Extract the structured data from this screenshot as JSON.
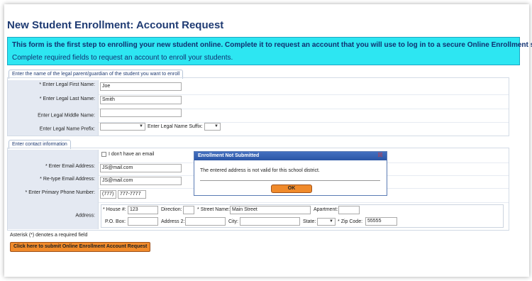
{
  "page": {
    "title": "New Student Enrollment: Account Request",
    "banner_bold": "This form is the first step to enrolling your new student online. Complete it to request an account that you will use to log in to a secure Online Enrollment system.",
    "banner_text": "Complete required fields to request an account to enroll your students."
  },
  "parent_section": {
    "tab": "Enter the name of the legal parent/guardian of the student you want to enroll",
    "first_name_label": "Enter Legal First Name:",
    "first_name_value": "Joe",
    "last_name_label": "Enter Legal Last Name:",
    "last_name_value": "Smith",
    "middle_name_label": "Enter Legal Middle Name:",
    "middle_name_value": "",
    "prefix_label": "Enter Legal Name Prefix:",
    "prefix_value": "",
    "suffix_label": "Enter Legal Name Suffix:",
    "suffix_value": ""
  },
  "contact_section": {
    "tab": "Enter contact information",
    "no_email_label": "I don't have an email",
    "email_label": "Enter Email Address:",
    "email_value": "JS@mail.com",
    "reemail_label": "Re-type Email Address:",
    "reemail_value": "JS@mail.com",
    "phone_label": "Enter Primary Phone Number:",
    "phone_area": "(777)",
    "phone_number": "777-7777",
    "address_label": "Address:",
    "house_label": "House #:",
    "house_value": "123",
    "direction_label": "Direction:",
    "street_label": "Street Name:",
    "street_value": "Main Street",
    "apartment_label": "Apartment:",
    "pobox_label": "P.O. Box:",
    "address2_label": "Address 2:",
    "city_label": "City:",
    "state_label": "State:",
    "zip_label": "Zip Code:",
    "zip_value": "55555"
  },
  "footer": {
    "required_note": "Asterisk (*) denotes a required field",
    "submit_label": "Click here to submit Online Enrollment Account Request"
  },
  "dialog": {
    "title": "Enrollment Not Submitted",
    "message": "The entered address is not valid for this school district.",
    "ok_label": "OK",
    "close_glyph": "☒"
  },
  "glyphs": {
    "required": "*",
    "dropdown": "▼"
  }
}
